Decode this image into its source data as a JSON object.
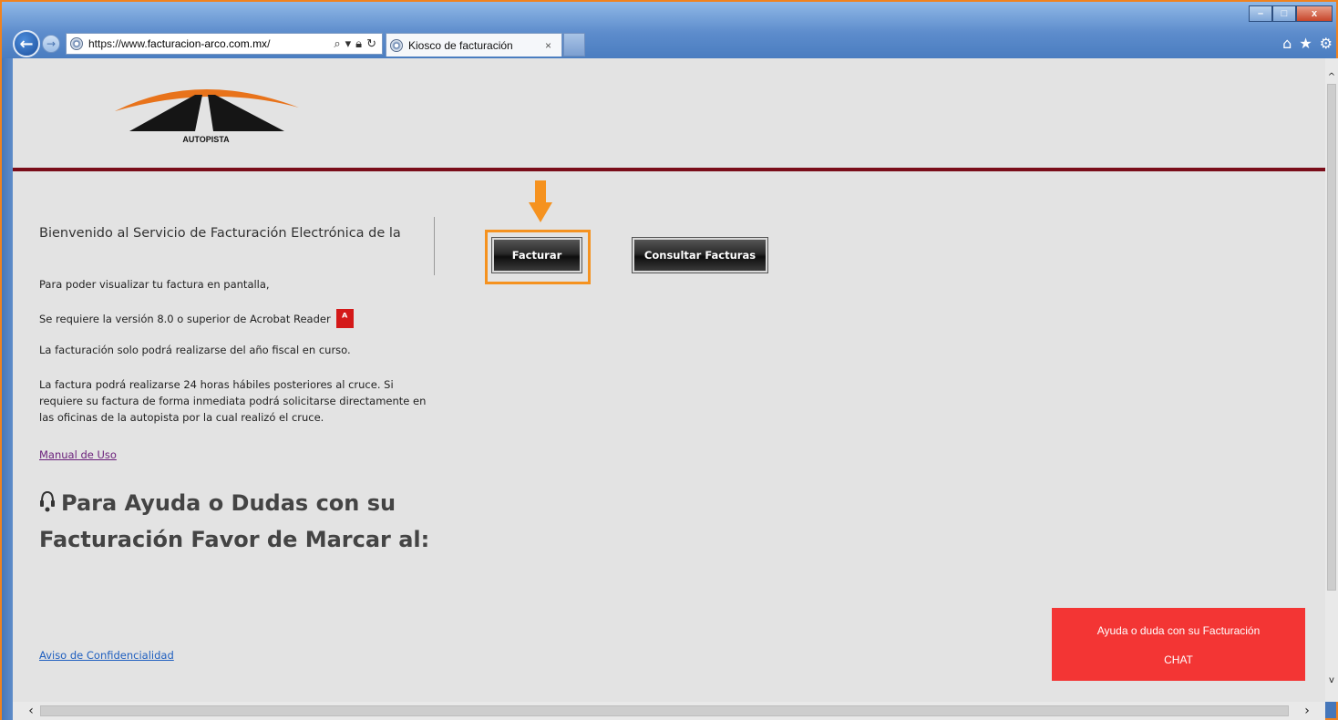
{
  "browser": {
    "url_prefix": "https://www.",
    "url_domain": "facturacion-arco.com.mx",
    "url_suffix": "/",
    "tab_title": "Kiosco de facturación",
    "tab_close": "×",
    "window_buttons": {
      "minimize": "–",
      "maximize": "□",
      "close": "x"
    }
  },
  "logo": {
    "text": "AUTOPISTA"
  },
  "content": {
    "welcome": "Bienvenido al Servicio de Facturación Electrónica de la",
    "info_1": "Para poder visualizar tu factura en pantalla,",
    "info_2": "Se requiere la versión 8.0 o superior de Acrobat Reader",
    "info_3": "La facturación solo podrá realizarse del año fiscal en curso.",
    "info_4": "La factura podrá realizarse 24 horas hábiles posteriores al cruce. Si requiere su factura de forma inmediata podrá solicitarse directamente en las oficinas de la autopista por la cual realizó el cruce.",
    "manual_link": "Manual de Uso",
    "help_title": "Para Ayuda o Dudas con su Facturación Favor de Marcar al:",
    "aviso_link": "Aviso de Confidencialidad"
  },
  "buttons": {
    "facturar": "Facturar",
    "consultar": "Consultar Facturas"
  },
  "chat": {
    "line1": "Ayuda o duda con su Facturación",
    "line2": "CHAT"
  },
  "colors": {
    "accent_orange": "#f5921f",
    "header_rule": "#7a0d1a",
    "chat_red": "#f33534",
    "page_bg": "#e3e3e3"
  }
}
